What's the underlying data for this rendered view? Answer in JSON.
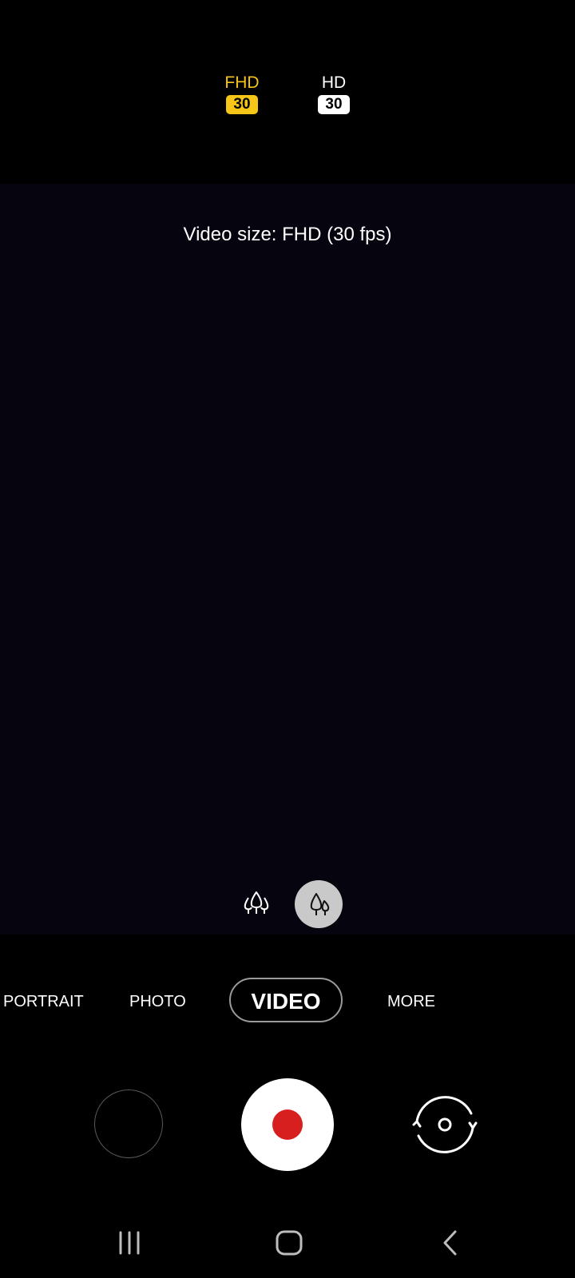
{
  "resolution": {
    "options": [
      {
        "label": "FHD",
        "fps": "30",
        "selected": true
      },
      {
        "label": "HD",
        "fps": "30",
        "selected": false
      }
    ],
    "selected_color": "#f5c518"
  },
  "toast": "Video size: FHD (30 fps)",
  "zoom": {
    "wide_icon": "three-trees-icon",
    "normal_icon": "two-trees-icon"
  },
  "modes": {
    "portrait": "PORTRAIT",
    "photo": "PHOTO",
    "video": "VIDEO",
    "more": "MORE"
  },
  "controls": {
    "record_color": "#d81f1f",
    "switch_icon": "camera-switch-icon"
  },
  "nav": {
    "recents_icon": "recents-icon",
    "home_icon": "home-icon",
    "back_icon": "back-icon"
  }
}
